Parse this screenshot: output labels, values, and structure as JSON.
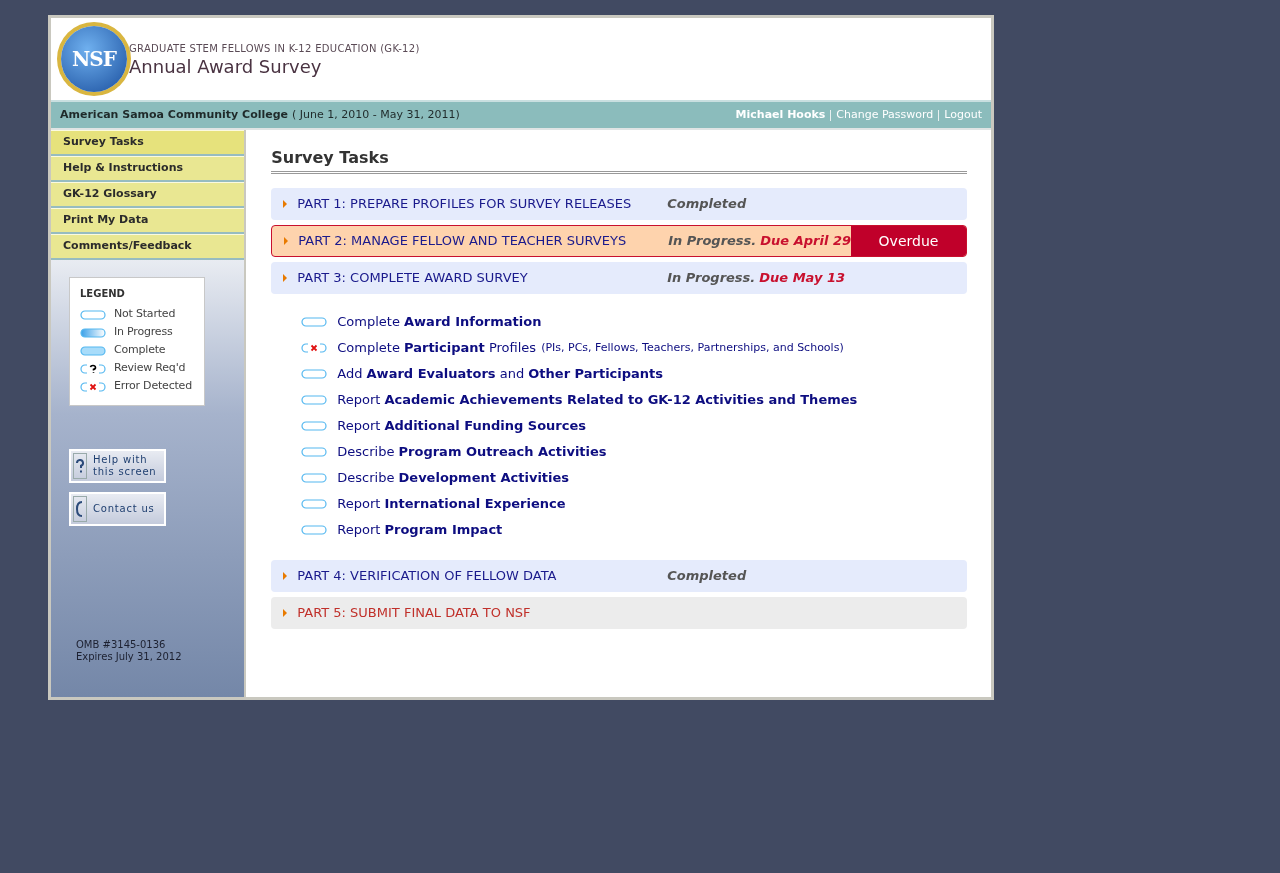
{
  "header": {
    "logo_text": "NSF",
    "program": "GRADUATE STEM FELLOWS IN K-12 EDUCATION (GK-12)",
    "title": "Annual Award Survey"
  },
  "info_bar": {
    "institution": "American Samoa Community College",
    "period": "( June 1, 2010 - May 31, 2011)",
    "user": "Michael Hooks",
    "links": [
      "Change Password",
      "Logout"
    ]
  },
  "sidebar": {
    "items": [
      {
        "label": "Survey Tasks",
        "selected": true
      },
      {
        "label": "Help & Instructions",
        "selected": false
      },
      {
        "label": "GK-12 Glossary",
        "selected": false
      },
      {
        "label": "Print My Data",
        "selected": false
      },
      {
        "label": "Comments/Feedback",
        "selected": false
      }
    ],
    "legend": {
      "title": "LEGEND",
      "items": [
        {
          "kind": "not_started",
          "label": "Not Started"
        },
        {
          "kind": "in_progress",
          "label": "In Progress"
        },
        {
          "kind": "complete",
          "label": "Complete"
        },
        {
          "kind": "review",
          "label": "Review Req'd"
        },
        {
          "kind": "error",
          "label": "Error Detected"
        }
      ]
    },
    "help_buttons": [
      {
        "kind": "help",
        "label": "Help with this screen"
      },
      {
        "kind": "contact",
        "label": "Contact us"
      }
    ],
    "omb": [
      "OMB #3145-0136",
      "Expires July 31, 2012"
    ]
  },
  "content": {
    "heading": "Survey Tasks",
    "parts": [
      {
        "kind": "normal",
        "label": "PART 1: PREPARE PROFILES FOR SURVEY RELEASES",
        "status": "Completed"
      },
      {
        "kind": "overdue",
        "label": "PART 2: MANAGE FELLOW AND TEACHER SURVEYS",
        "status": "In Progress.",
        "due": "Due April 29",
        "badge": "Overdue"
      },
      {
        "kind": "normal",
        "label": "PART 3: COMPLETE AWARD SURVEY",
        "status": "In Progress.",
        "due": "Due May 13",
        "tasks": [
          {
            "kind": "not_started",
            "text": "Complete **Award Information**"
          },
          {
            "kind": "error",
            "text": "Complete **Participant** Profiles",
            "note": "(PIs, PCs, Fellows, Teachers, Partnerships, and Schools)"
          },
          {
            "kind": "not_started",
            "text": "Add **Award Evaluators** and **Other Participants**"
          },
          {
            "kind": "not_started",
            "text": "Report **Academic Achievements Related to GK-12 Activities and Themes**"
          },
          {
            "kind": "not_started",
            "text": "Report **Additional Funding Sources**"
          },
          {
            "kind": "not_started",
            "text": "Describe **Program Outreach Activities**"
          },
          {
            "kind": "not_started",
            "text": "Describe **Development Activities**"
          },
          {
            "kind": "not_started",
            "text": "Report **International Experience**"
          },
          {
            "kind": "not_started",
            "text": "Report **Program Impact**"
          }
        ]
      },
      {
        "kind": "normal",
        "label": "PART 4: VERIFICATION OF FELLOW DATA",
        "status": "Completed"
      },
      {
        "kind": "locked",
        "label": "PART 5: SUBMIT FINAL DATA TO NSF"
      }
    ]
  }
}
